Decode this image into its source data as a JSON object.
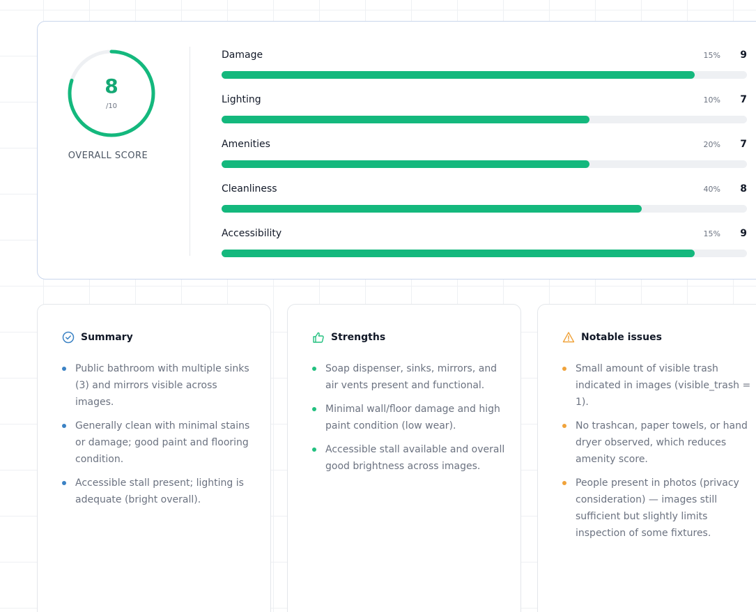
{
  "overall": {
    "score": "8",
    "max": "/10",
    "label": "OVERALL SCORE",
    "fraction": 0.8
  },
  "metrics": [
    {
      "name": "Damage",
      "weight": "15%",
      "score": "9",
      "fill": 0.9
    },
    {
      "name": "Lighting",
      "weight": "10%",
      "score": "7",
      "fill": 0.7
    },
    {
      "name": "Amenities",
      "weight": "20%",
      "score": "7",
      "fill": 0.7
    },
    {
      "name": "Cleanliness",
      "weight": "40%",
      "score": "8",
      "fill": 0.8
    },
    {
      "name": "Accessibility",
      "weight": "15%",
      "score": "9",
      "fill": 0.9
    }
  ],
  "colors": {
    "accent": "#14b87d",
    "summary": "#3b82c4",
    "strengths": "#22c07f",
    "issues": "#f0a33b"
  },
  "panels": {
    "summary": {
      "title": "Summary",
      "icon": "check-circle-icon",
      "items": [
        "Public bathroom with multiple sinks (3) and mirrors visible across images.",
        "Generally clean with minimal stains or damage; good paint and flooring condition.",
        "Accessible stall present; lighting is adequate (bright overall)."
      ]
    },
    "strengths": {
      "title": "Strengths",
      "icon": "thumbs-up-icon",
      "items": [
        "Soap dispenser, sinks, mirrors, and air vents present and functional.",
        "Minimal wall/floor damage and high paint condition (low wear).",
        "Accessible stall available and overall good brightness across images."
      ]
    },
    "issues": {
      "title": "Notable issues",
      "icon": "warning-triangle-icon",
      "items": [
        "Small amount of visible trash indicated in images (visible_trash = 1).",
        "No trashcan, paper towels, or hand dryer observed, which reduces amenity score.",
        "People present in photos (privacy consideration) — images still sufficient but slightly limits inspection of some fixtures."
      ]
    }
  }
}
